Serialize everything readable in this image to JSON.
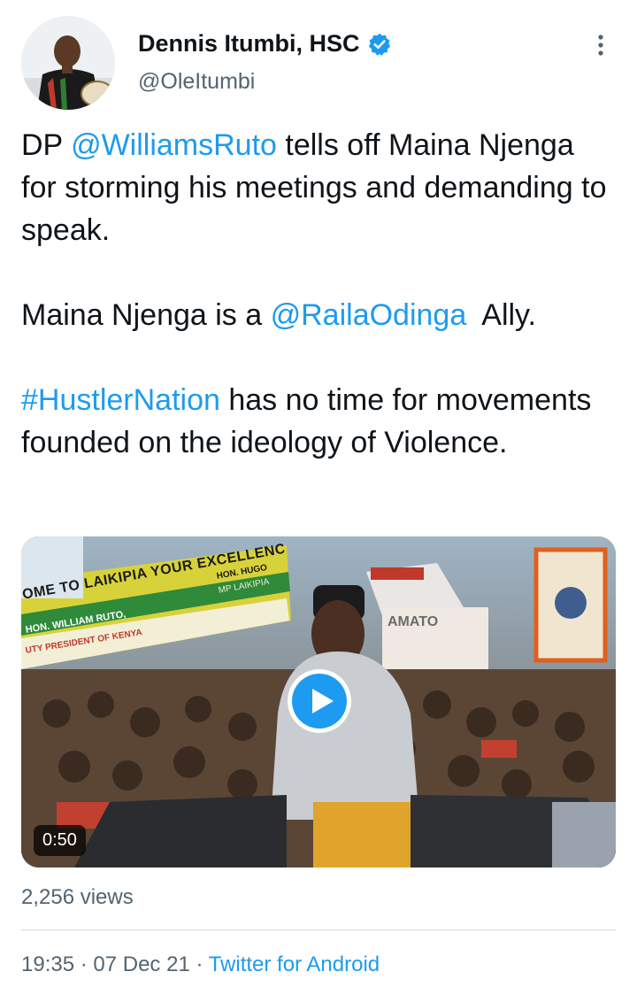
{
  "author": {
    "display_name": "Dennis Itumbi, HSC",
    "handle": "@OleItumbi",
    "verified": true
  },
  "tweet": {
    "lines": [
      [
        {
          "text": "DP "
        },
        {
          "text": "@WilliamsRuto",
          "link": true
        },
        {
          "text": " tells off Maina Njenga for storming his meetings and demanding to speak."
        }
      ],
      [
        {
          "text": "Maina Njenga is a "
        },
        {
          "text": "@RailaOdinga",
          "link": true
        },
        {
          "text": "  Ally."
        }
      ],
      [
        {
          "text": "#HustlerNation",
          "link": true
        },
        {
          "text": " has no time for movements founded on the ideology of Violence."
        }
      ]
    ]
  },
  "media": {
    "type": "video",
    "duration": "0:50",
    "banner_text": "OME TO LAIKIPIA YOUR EXCELLENCY",
    "banner_subtext_1": "HON. WILLIAM RUTO,",
    "banner_subtext_2": "UTY PRESIDENT OF KENYA",
    "banner_corner_1": "HON. HUGO",
    "banner_corner_2": "MP LAIKIPIA",
    "sign_text": "AMATO"
  },
  "stats": {
    "views": "2,256 views"
  },
  "meta": {
    "time": "19:35",
    "separator": " · ",
    "date": "07 Dec 21",
    "source": "Twitter for Android"
  },
  "colors": {
    "link": "#1d9bf0",
    "secondary_text": "#536471",
    "verified_badge": "#1d9bf0"
  },
  "icons": [
    "verified-badge-icon",
    "more-options-icon",
    "play-icon"
  ]
}
